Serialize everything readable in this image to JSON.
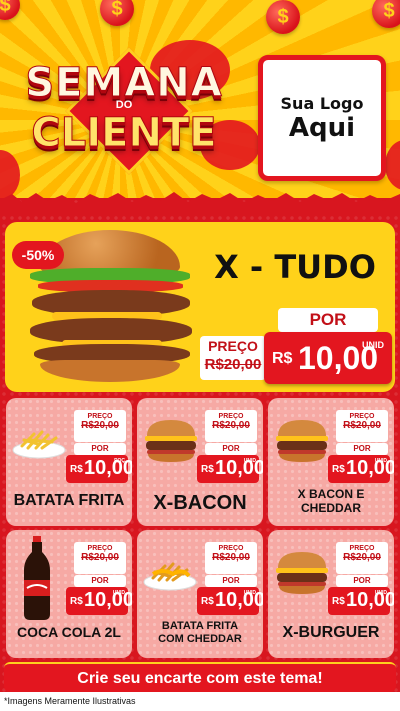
{
  "header": {
    "title_line1": "SEMANA",
    "title_line2": "DO",
    "title_line3": "CLIENTE",
    "logo_line1": "Sua Logo",
    "logo_line2": "Aqui",
    "coin_symbol": "$"
  },
  "featured": {
    "discount": "-50%",
    "name": "X - TUDO",
    "preco_label": "PREÇO",
    "old_price": "R$20,00",
    "por_label": "POR",
    "currency": "R$",
    "price": "10,00",
    "unid": "UNID"
  },
  "products": [
    {
      "name": "BATATA FRITA",
      "preco_label": "PREÇO",
      "old_price": "R$20,00",
      "por_label": "POR",
      "currency": "R$",
      "price": "10,00",
      "unid": "POÇ",
      "image": "fries-icon"
    },
    {
      "name": "X-BACON",
      "preco_label": "PREÇO",
      "old_price": "R$20,00",
      "por_label": "POR",
      "currency": "R$",
      "price": "10,00",
      "unid": "UNID",
      "image": "burger-icon"
    },
    {
      "name": "X BACON E CHEDDAR",
      "preco_label": "PREÇO",
      "old_price": "R$20,00",
      "por_label": "POR",
      "currency": "R$",
      "price": "10,00",
      "unid": "UNID",
      "image": "burger-icon"
    },
    {
      "name": "COCA COLA 2L",
      "preco_label": "PREÇO",
      "old_price": "R$20,00",
      "por_label": "POR",
      "currency": "R$",
      "price": "10,00",
      "unid": "UNID",
      "image": "soda-bottle-icon"
    },
    {
      "name": "BATATA FRITA COM CHEDDAR",
      "preco_label": "PREÇO",
      "old_price": "R$20,00",
      "por_label": "POR",
      "currency": "R$",
      "price": "10,00",
      "unid": "UNID",
      "image": "fries-cheddar-icon"
    },
    {
      "name": "X-BURGUER",
      "preco_label": "PREÇO",
      "old_price": "R$20,00",
      "por_label": "POR",
      "currency": "R$",
      "price": "10,00",
      "unid": "UNID",
      "image": "burger-icon"
    }
  ],
  "footer": {
    "cta": "Crie seu encarte com este tema!",
    "note": "*Imagens Meramente Ilustrativas"
  },
  "colors": {
    "primary_red": "#e3161f",
    "accent_yellow": "#ffd21a",
    "card_pink": "#f6a9a4"
  }
}
